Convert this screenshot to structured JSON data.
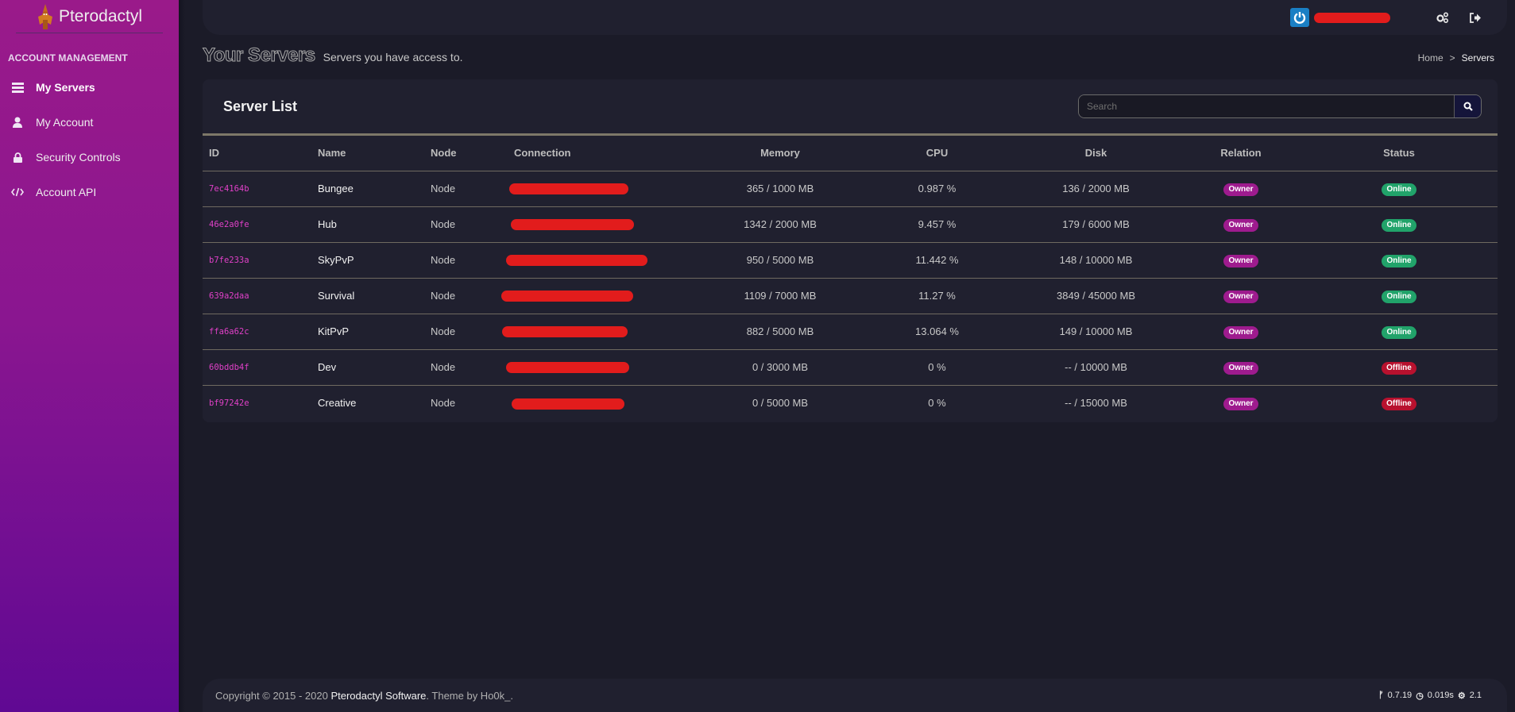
{
  "brand": {
    "name": "Pterodactyl",
    "logo_icon": "pterodactyl-logo"
  },
  "sidebar": {
    "header": "ACCOUNT MANAGEMENT",
    "items": [
      {
        "label": "My Servers",
        "icon": "server-icon",
        "active": true
      },
      {
        "label": "My Account",
        "icon": "user-icon",
        "active": false
      },
      {
        "label": "Security Controls",
        "icon": "lock-icon",
        "active": false
      },
      {
        "label": "Account API",
        "icon": "code-icon",
        "active": false
      }
    ]
  },
  "topbar": {
    "user_icon": "power-icon",
    "username": "[redacted]",
    "admin_icon": "cogs-icon",
    "logout_icon": "sign-out-icon"
  },
  "page": {
    "title": "Your Servers",
    "subtitle": "Servers you have access to."
  },
  "breadcrumb": {
    "home": "Home",
    "separator": ">",
    "current": "Servers"
  },
  "server_list": {
    "title": "Server List",
    "search": {
      "placeholder": "Search",
      "value": ""
    },
    "columns": [
      "ID",
      "Name",
      "Node",
      "Connection",
      "Memory",
      "CPU",
      "Disk",
      "Relation",
      "Status"
    ],
    "rows": [
      {
        "id": "7ec4164b",
        "name": "Bungee",
        "node": "Node",
        "connection": "[redacted]",
        "memory": "365 / 1000 MB",
        "cpu": "0.987 %",
        "disk": "136 / 2000 MB",
        "relation": "Owner",
        "status": "Online"
      },
      {
        "id": "46e2a0fe",
        "name": "Hub",
        "node": "Node",
        "connection": "[redacted]",
        "memory": "1342 / 2000 MB",
        "cpu": "9.457 %",
        "disk": "179 / 6000 MB",
        "relation": "Owner",
        "status": "Online"
      },
      {
        "id": "b7fe233a",
        "name": "SkyPvP",
        "node": "Node",
        "connection": "[redacted]",
        "memory": "950 / 5000 MB",
        "cpu": "11.442 %",
        "disk": "148 / 10000 MB",
        "relation": "Owner",
        "status": "Online"
      },
      {
        "id": "639a2daa",
        "name": "Survival",
        "node": "Node",
        "connection": "[redacted]",
        "memory": "1109 / 7000 MB",
        "cpu": "11.27 %",
        "disk": "3849 / 45000 MB",
        "relation": "Owner",
        "status": "Online"
      },
      {
        "id": "ffa6a62c",
        "name": "KitPvP",
        "node": "Node",
        "connection": "[redacted]",
        "memory": "882 / 5000 MB",
        "cpu": "13.064 %",
        "disk": "149 / 10000 MB",
        "relation": "Owner",
        "status": "Online"
      },
      {
        "id": "60bddb4f",
        "name": "Dev",
        "node": "Node",
        "connection": "[redacted]",
        "memory": "0 / 3000 MB",
        "cpu": "0 %",
        "disk": "-- / 10000 MB",
        "relation": "Owner",
        "status": "Offline"
      },
      {
        "id": "bf97242e",
        "name": "Creative",
        "node": "Node",
        "connection": "[redacted]",
        "memory": "0 / 5000 MB",
        "cpu": "0 %",
        "disk": "-- / 15000 MB",
        "relation": "Owner",
        "status": "Offline"
      }
    ]
  },
  "footer": {
    "copyright": "Copyright © 2015 - 2020 ",
    "brand_link": "Pterodactyl Software",
    "theme_text": ". Theme by Ho0k_.",
    "version": "0.7.19",
    "render_time": "0.019s",
    "theme_version": "2.1"
  },
  "colors": {
    "sidebar_top": "#9a1a8a",
    "sidebar_bottom": "#600993",
    "background": "#1b1b28",
    "panel": "#20202f",
    "id_text": "#e040c8",
    "owner_badge": "#9e1b8e",
    "online_badge": "#21a36a",
    "offline_badge": "#b8112e",
    "redaction": "#e21c1c"
  }
}
